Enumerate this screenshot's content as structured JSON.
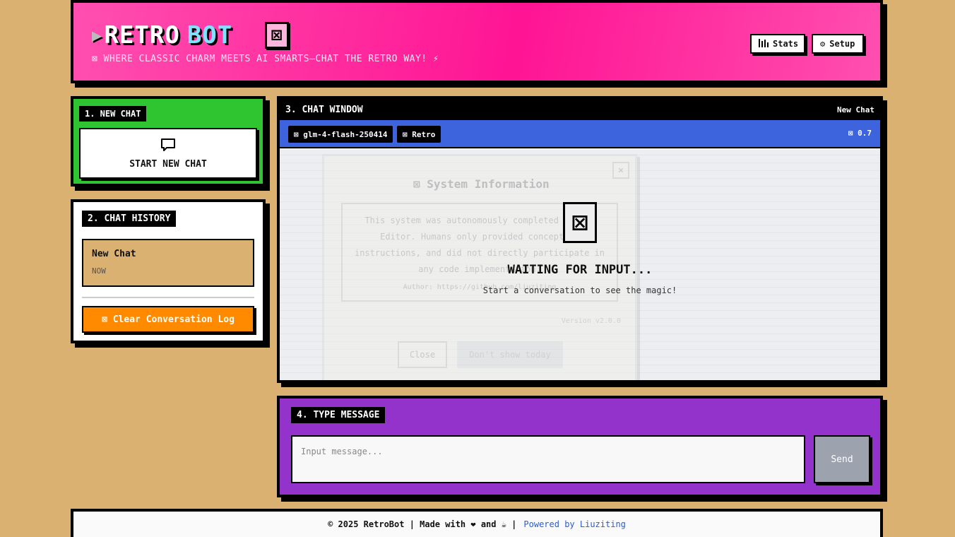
{
  "header": {
    "logo_arrow": "▶",
    "logo_word1": "RETRO",
    "logo_word2": "BOT",
    "logo_box": "⊠",
    "tagline": "⊠ WHERE CLASSIC CHARM MEETS AI SMARTS—CHAT THE RETRO WAY! ⚡",
    "stats_label": "Stats",
    "setup_label": "Setup",
    "stats_icon": "📊",
    "setup_icon": "⚙"
  },
  "new_chat": {
    "section": "1. NEW CHAT",
    "button_label": "START NEW CHAT"
  },
  "history": {
    "section": "2. CHAT HISTORY",
    "items": [
      {
        "title": "New Chat",
        "time": "NOW"
      }
    ],
    "clear_label": "⊠ Clear Conversation Log"
  },
  "chat": {
    "section": "3. CHAT WINDOW",
    "current": "New Chat",
    "model": "⊠ glm-4-flash-250414",
    "style": "⊠ Retro",
    "temperature": "⊠ 0.7",
    "waiting_icon": "⊠",
    "waiting_title": "WAITING FOR INPUT...",
    "waiting_sub": "Start a conversation to see the magic!",
    "system_modal": {
      "title": "⊠ System Information",
      "close_x": "✕",
      "message": "This system was autonomously completed by the Editor. Humans only provided conceptual instructions, and did not directly participate in any code implementation.",
      "author": "Author: https://github.com/liuziting",
      "version": "Version v2.0.0",
      "close_label": "Close",
      "dont_show_label": "Don't show today"
    }
  },
  "type_message": {
    "section": "4. TYPE MESSAGE",
    "placeholder": "Input message...",
    "send_label": "Send"
  },
  "footer": {
    "text": "© 2025 RetroBot | Made with ❤ and ☕ |",
    "link": "Powered by Liuziting"
  }
}
